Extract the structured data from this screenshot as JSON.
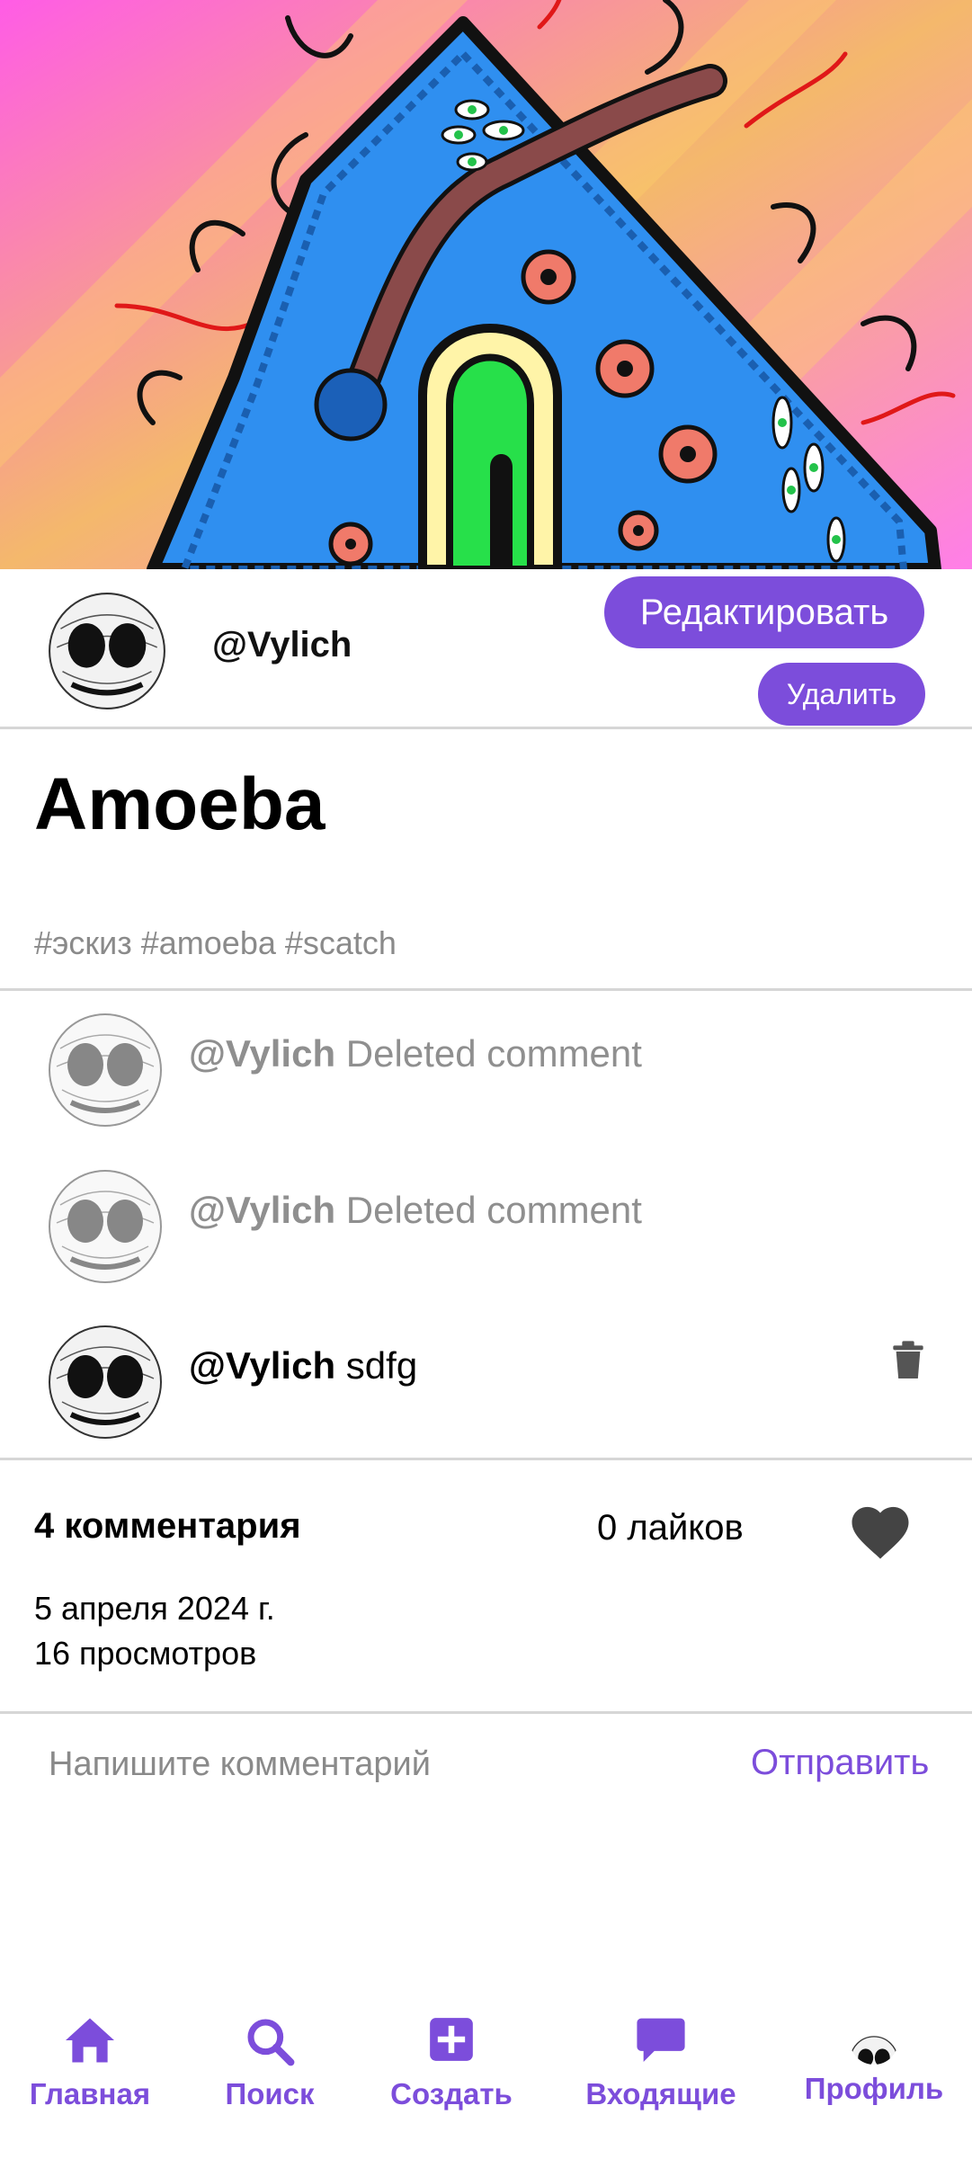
{
  "post": {
    "author": "@Vylich",
    "title": "Amoeba",
    "tags": "#эскиз #amoeba #scatch",
    "edit_label": "Редактировать",
    "delete_label": "Удалить"
  },
  "comments": [
    {
      "user": "@Vylich",
      "text": "Deleted comment",
      "deleted": true
    },
    {
      "user": "@Vylich",
      "text": "Deleted comment",
      "deleted": true
    },
    {
      "user": "@Vylich",
      "text": "sdfg",
      "deleted": false
    }
  ],
  "stats": {
    "comments": "4 комментария",
    "likes": "0 лайков",
    "date": "5 апреля 2024 г.",
    "views": "16 просмотров"
  },
  "comment_form": {
    "placeholder": "Напишите комментарий",
    "send_label": "Отправить"
  },
  "nav": {
    "home": "Главная",
    "search": "Поиск",
    "create": "Создать",
    "inbox": "Входящие",
    "profile": "Профиль"
  },
  "colors": {
    "accent": "#7c4ddb",
    "muted_text": "#8a8a8a",
    "divider": "#d6d6d6"
  },
  "icons": [
    "trash-icon",
    "heart-icon",
    "home-icon",
    "search-icon",
    "create-icon",
    "inbox-icon"
  ]
}
